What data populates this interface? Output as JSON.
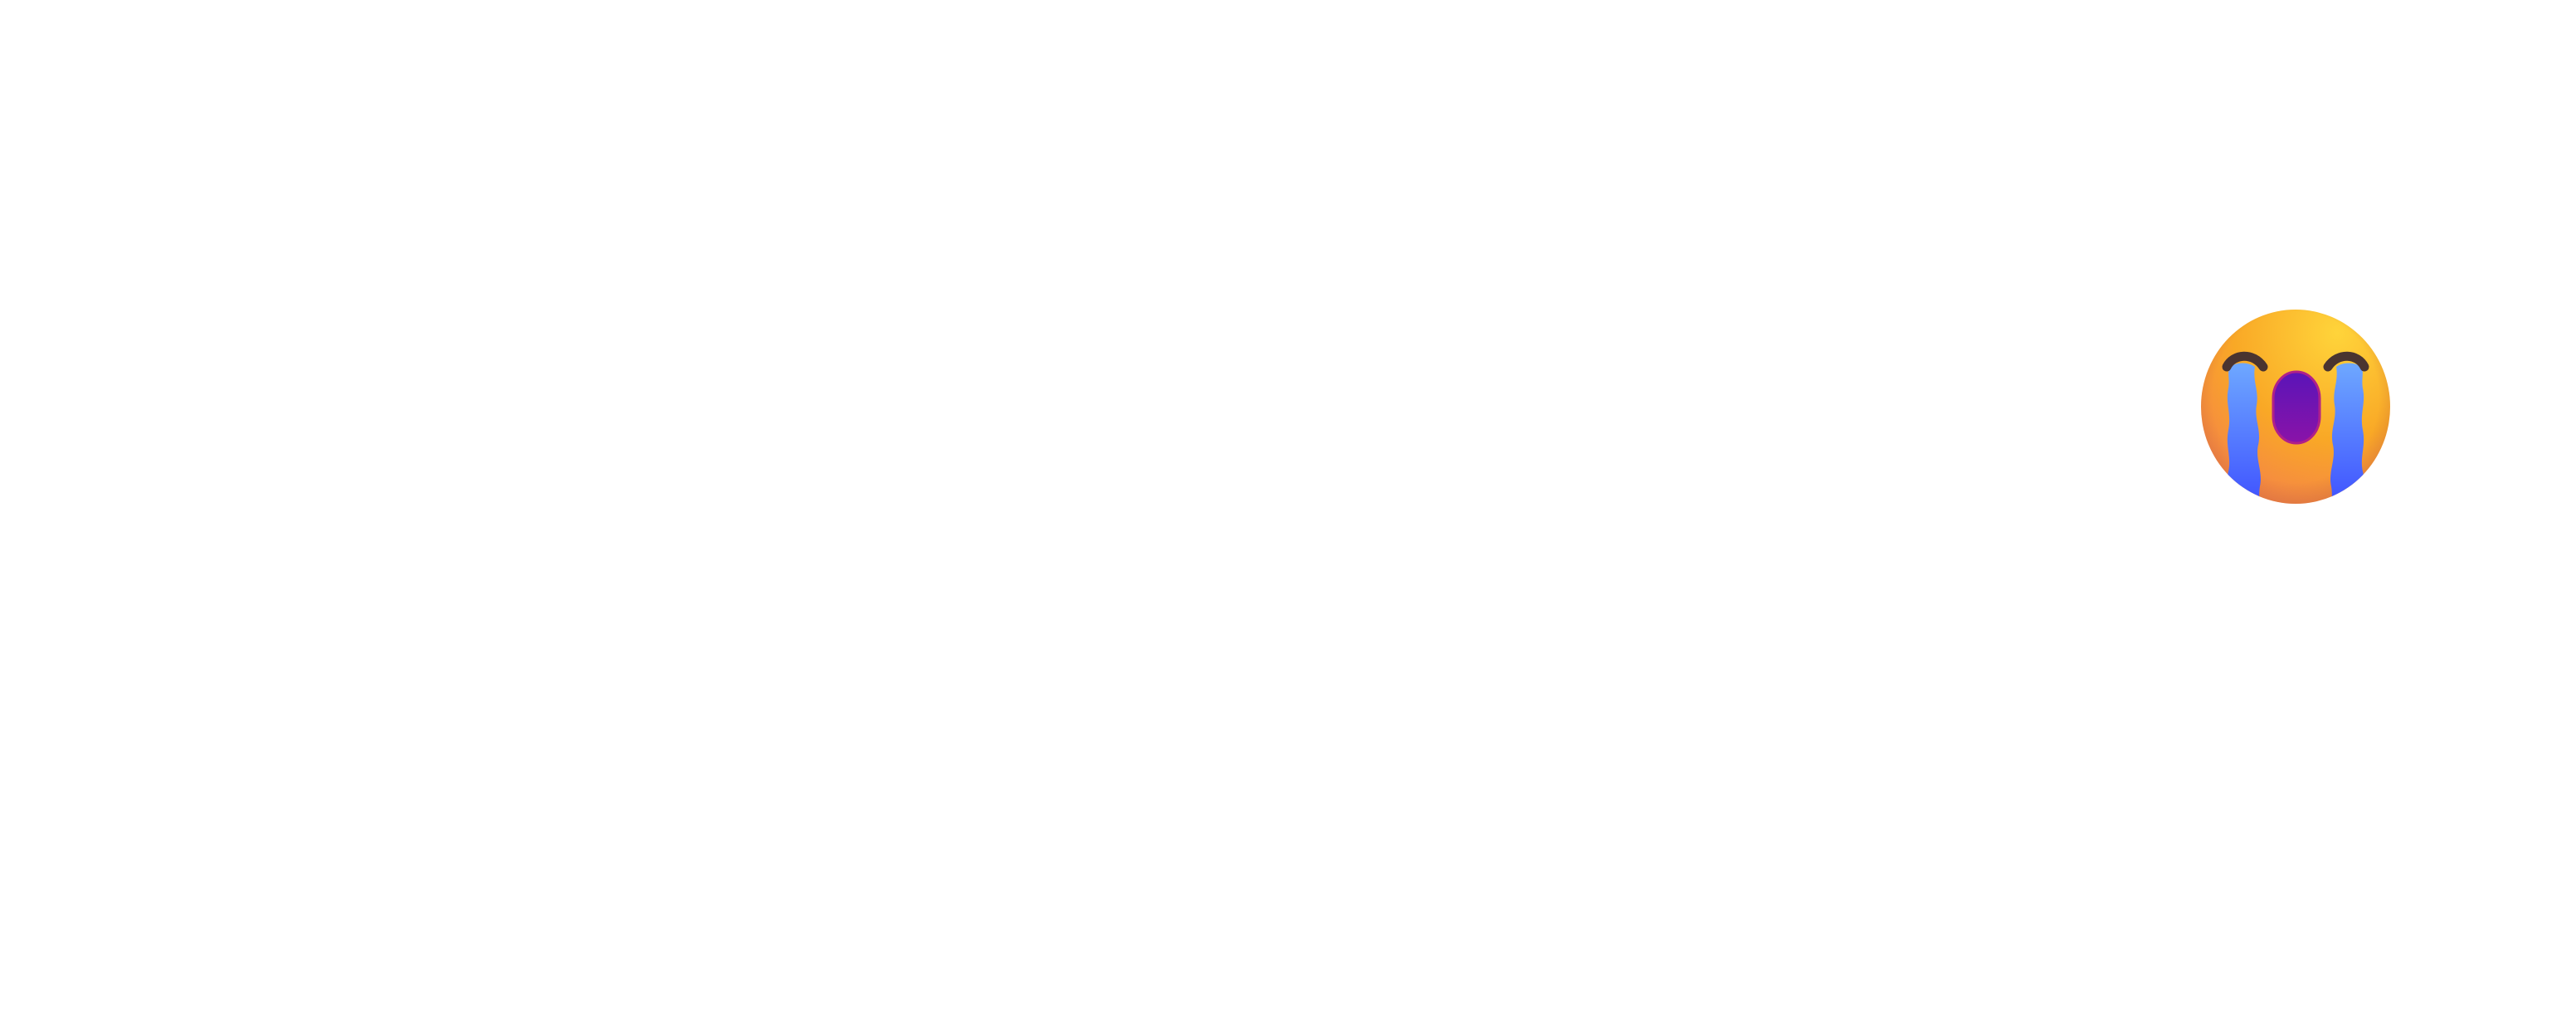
{
  "background_color": "#ffffff",
  "emoji": {
    "icon": "loudly-crying-face-icon",
    "colors": {
      "face_top": "#ffd43a",
      "face_middle": "#f9a826",
      "face_bottom": "#f47f4c",
      "chin_glow": "#ff6fa5",
      "tears_top": "#6ea8ff",
      "tears_bottom": "#3b4bff",
      "mouth_top": "#5a14b8",
      "mouth_bottom": "#8a13a8",
      "eyes": "#4a3430"
    }
  }
}
